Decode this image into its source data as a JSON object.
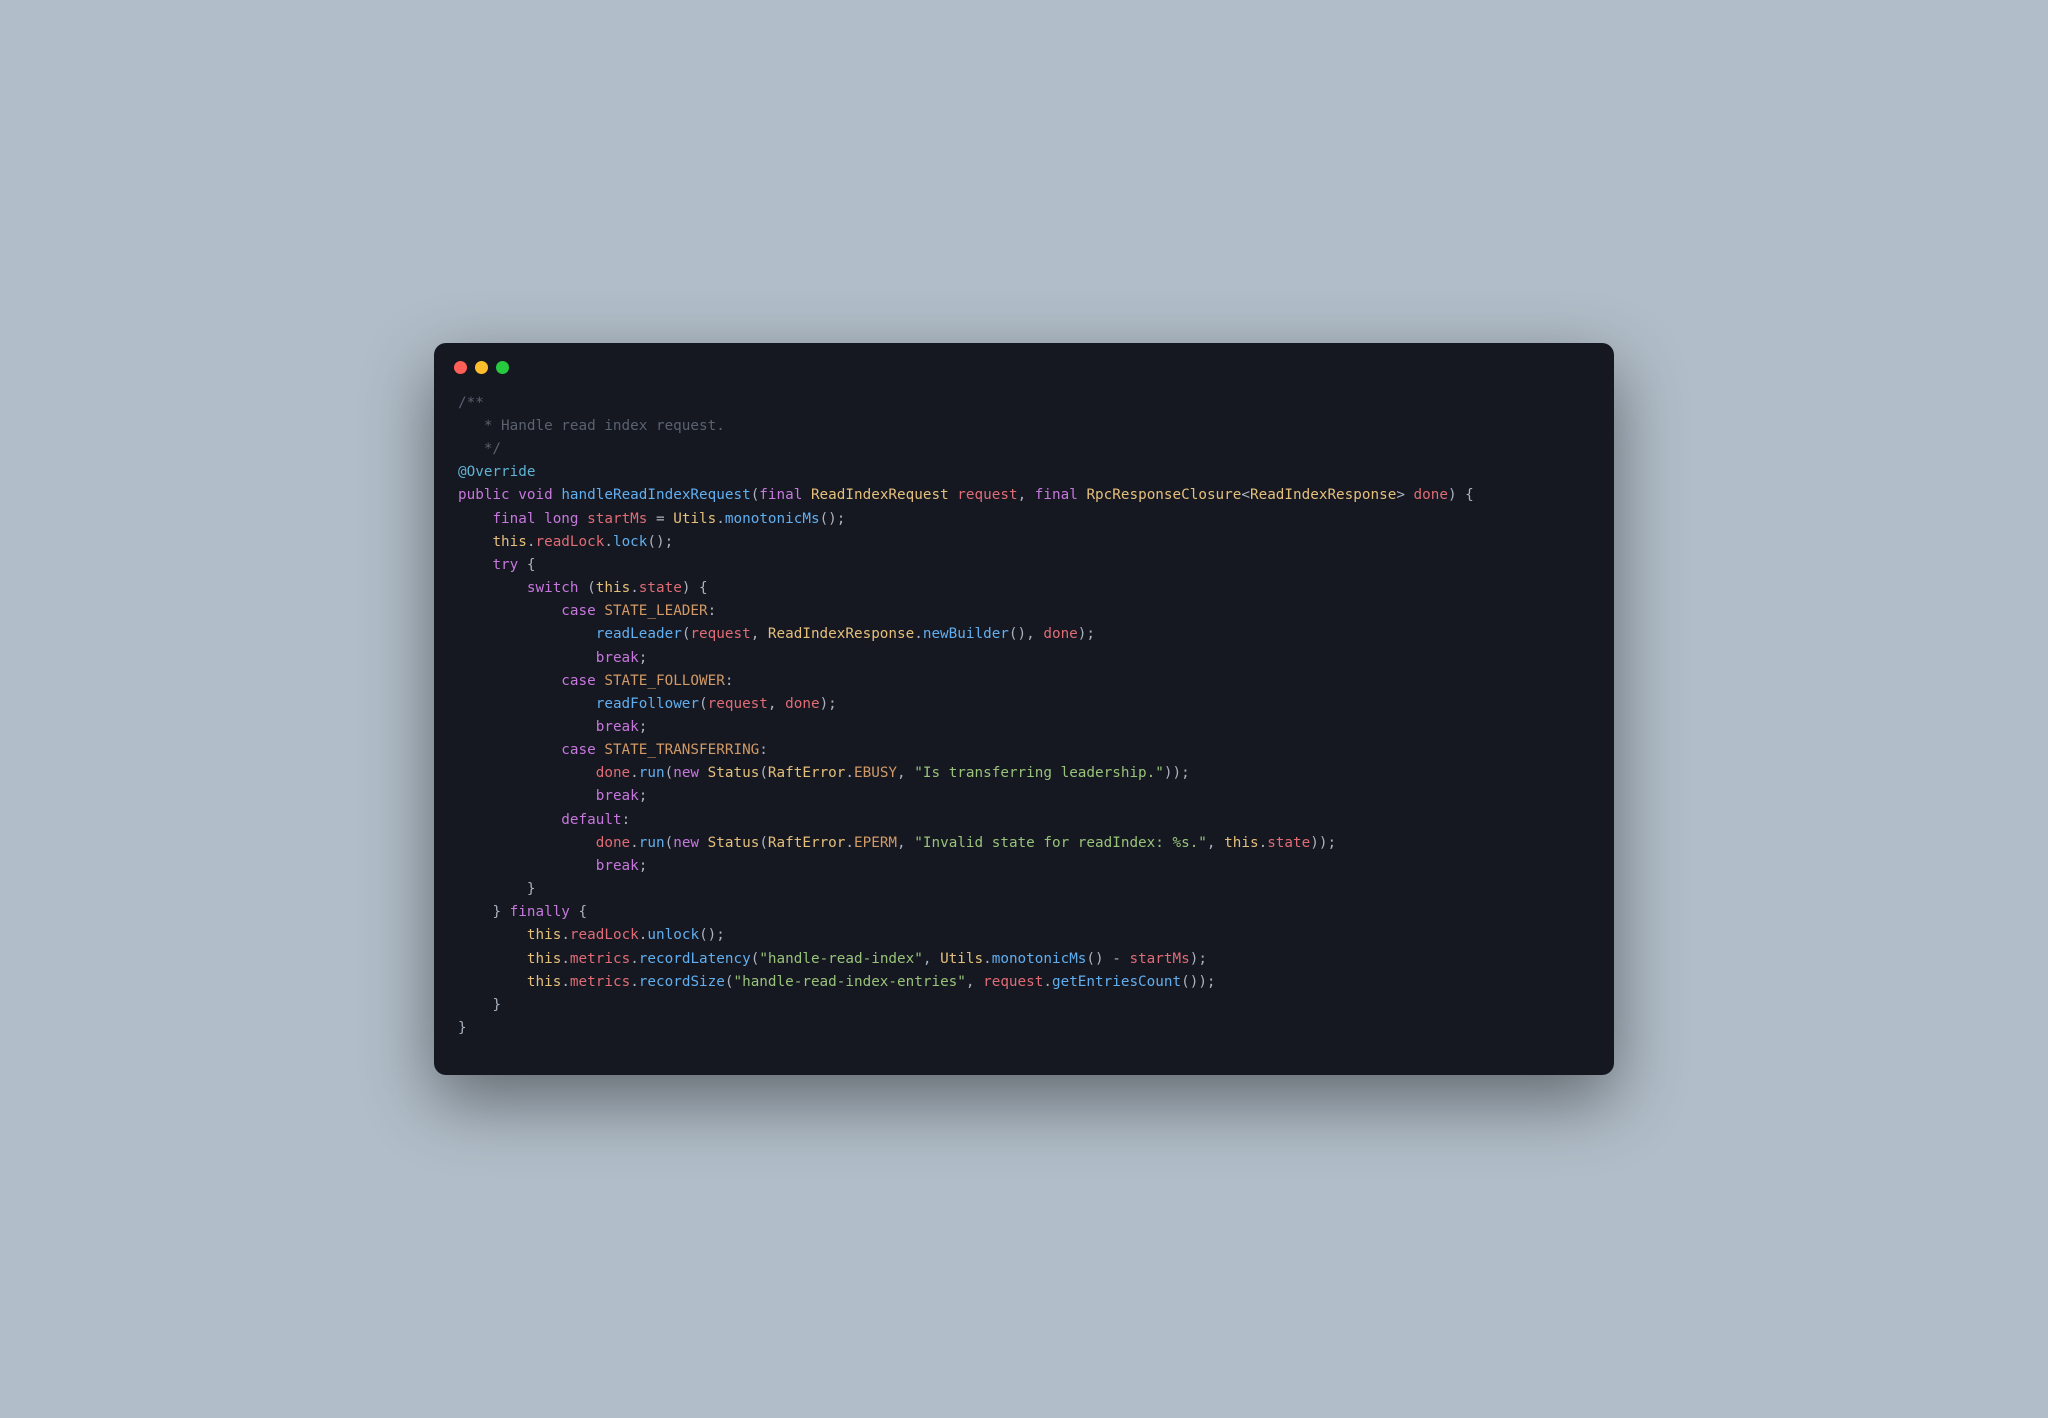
{
  "colors": {
    "bg_page": "#b1bdc8",
    "bg_window": "#151721",
    "comment": "#5a6270",
    "annotation": "#5fb3d4",
    "keyword": "#c678dd",
    "method": "#61afef",
    "type": "#e5c07b",
    "variable": "#d19a66",
    "param": "#e06c75",
    "string": "#98c379",
    "punct": "#abb2bf"
  },
  "code": {
    "comment_open": "/**",
    "comment_body": "   * Handle read index request.",
    "comment_close": "   */",
    "annotation": "@Override",
    "kw_public": "public",
    "kw_void": "void",
    "method_name": "handleReadIndexRequest",
    "kw_final": "final",
    "type_ReadIndexRequest": "ReadIndexRequest",
    "param_request": "request",
    "type_RpcResponseClosure": "RpcResponseClosure",
    "type_ReadIndexResponse": "ReadIndexResponse",
    "param_done": "done",
    "kw_long": "long",
    "var_startMs": "startMs",
    "type_Utils": "Utils",
    "call_monotonicMs": "monotonicMs",
    "this_kw": "this",
    "prop_readLock": "readLock",
    "call_lock": "lock",
    "kw_try": "try",
    "kw_switch": "switch",
    "prop_state": "state",
    "kw_case": "case",
    "const_STATE_LEADER": "STATE_LEADER",
    "call_readLeader": "readLeader",
    "call_newBuilder": "newBuilder",
    "kw_break": "break",
    "const_STATE_FOLLOWER": "STATE_FOLLOWER",
    "call_readFollower": "readFollower",
    "const_STATE_TRANSFERRING": "STATE_TRANSFERRING",
    "call_run": "run",
    "kw_new": "new",
    "type_Status": "Status",
    "type_RaftError": "RaftError",
    "const_EBUSY": "EBUSY",
    "str_transferring": "\"Is transferring leadership.\"",
    "kw_default": "default",
    "const_EPERM": "EPERM",
    "str_invalid": "\"Invalid state for readIndex: %s.\"",
    "kw_finally": "finally",
    "call_unlock": "unlock",
    "prop_metrics": "metrics",
    "call_recordLatency": "recordLatency",
    "str_handle_read_index": "\"handle-read-index\"",
    "call_recordSize": "recordSize",
    "str_handle_read_index_entries": "\"handle-read-index-entries\"",
    "call_getEntriesCount": "getEntriesCount"
  }
}
